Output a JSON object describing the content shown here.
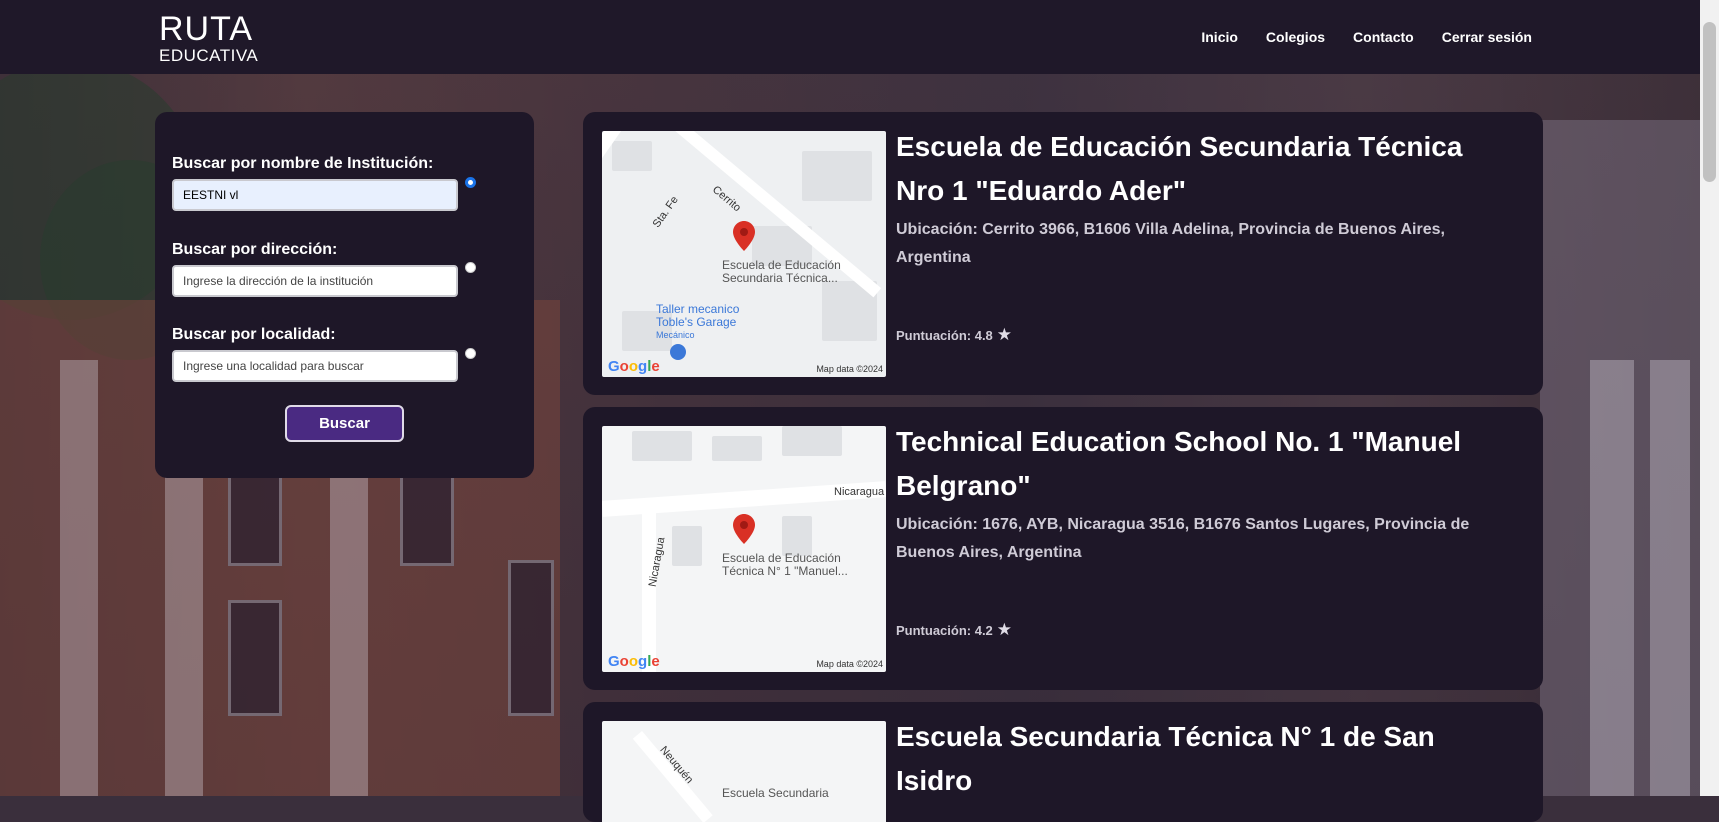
{
  "brand": {
    "line1": "RUTA",
    "line2": "EDUCATIVA"
  },
  "nav": {
    "items": [
      "Inicio",
      "Colegios",
      "Contacto",
      "Cerrar sesión"
    ]
  },
  "search": {
    "name_label": "Buscar por nombre de Institución:",
    "name_value": "EESTNI vl",
    "address_label": "Buscar por dirección:",
    "address_placeholder": "Ingrese la dirección de la institución",
    "locality_label": "Buscar por localidad:",
    "locality_placeholder": "Ingrese una localidad para buscar",
    "selected_option": "name",
    "button": "Buscar"
  },
  "results": [
    {
      "title": "Escuela de Educación Secundaria Técnica Nro 1 \"Eduardo Ader\"",
      "address": "Ubicación: Cerrito 3966, B1606 Villa Adelina, Provincia de Buenos Aires, Argentina",
      "score": "Puntuación: 4.8",
      "map": {
        "pin_label_1": "Escuela de Educación",
        "pin_label_2": "Secundaria Técnica...",
        "poi_1": "Taller mecanico",
        "poi_2": "Toble's Garage",
        "poi_3": "Mecánico",
        "street_1": "Sta. Fe",
        "street_2": "Cerrito",
        "google": "Google",
        "map_data": "Map data ©2024"
      }
    },
    {
      "title": "Technical Education School No. 1 \"Manuel Belgrano\"",
      "address": "Ubicación: 1676, AYB, Nicaragua 3516, B1676 Santos Lugares, Provincia de Buenos Aires, Argentina",
      "score": "Puntuación: 4.2",
      "map": {
        "pin_label_1": "Escuela de Educación",
        "pin_label_2": "Técnica N° 1 \"Manuel...",
        "street_1": "Nicaragua",
        "street_2": "Nicaragua",
        "google": "Google",
        "map_data": "Map data ©2024"
      }
    },
    {
      "title": "Escuela Secundaria Técnica N° 1 de San Isidro",
      "map": {
        "pin_label_1": "Escuela Secundaria",
        "street_1": "Neuquén"
      }
    }
  ],
  "colors": {
    "topbar": "#1f1829",
    "panel": "#1e1728",
    "button": "#4a2a82",
    "pin": "#d93025"
  }
}
